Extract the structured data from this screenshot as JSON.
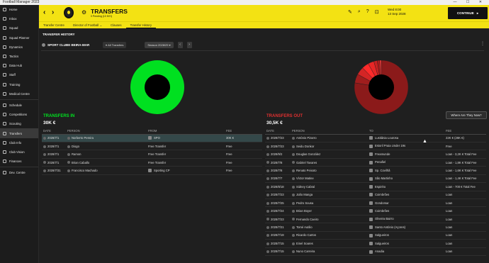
{
  "window": {
    "title": "Football Manager 2023"
  },
  "sidebar": {
    "items": [
      {
        "label": "Home",
        "icon": "home-icon"
      },
      {
        "label": "Inbox",
        "icon": "inbox-icon"
      },
      {
        "label": "Squad",
        "icon": "squad-icon"
      },
      {
        "label": "Squad Planner",
        "icon": "planner-icon"
      },
      {
        "label": "Dynamics",
        "icon": "dynamics-icon"
      },
      {
        "label": "Tactics",
        "icon": "tactics-icon"
      },
      {
        "label": "Data Hub",
        "icon": "data-icon"
      },
      {
        "label": "Staff",
        "icon": "staff-icon"
      },
      {
        "label": "Training",
        "icon": "training-icon"
      },
      {
        "label": "Medical Centre",
        "icon": "medical-icon"
      },
      {
        "label": "Schedule",
        "icon": "calendar-icon"
      },
      {
        "label": "Competitions",
        "icon": "trophy-icon"
      },
      {
        "label": "Scouting",
        "icon": "scouting-icon"
      },
      {
        "label": "Transfers",
        "icon": "transfers-icon"
      },
      {
        "label": "Club Info",
        "icon": "club-icon"
      },
      {
        "label": "Club Vision",
        "icon": "vision-icon"
      },
      {
        "label": "Finances",
        "icon": "finances-icon"
      },
      {
        "label": "Dev. Centre",
        "icon": "dev-icon"
      }
    ]
  },
  "header": {
    "title": "TRANSFERS",
    "subtitle": "0 Pending (10 H/H)",
    "date_line1": "Wed 8:00",
    "date_line2": "13 Sep 2028",
    "continue_label": "CONTINUE"
  },
  "subnav": {
    "tabs": [
      "Transfer Centre",
      "Director of Football",
      "Clauses",
      "Transfer History"
    ]
  },
  "main": {
    "section_title": "TRANSFER HISTORY",
    "club_name": "SPORT CLUBE BEIRA-MAR",
    "filter_label": "All Transfers",
    "season_label": "Season 2028/29",
    "where_button": "Where Are They Now?"
  },
  "colors": {
    "accent": "#f3e213",
    "in": "#00e020",
    "out": "#e03030"
  },
  "chart_data": [
    {
      "type": "pie",
      "title": "",
      "slices": [
        {
          "label": "Transfers In",
          "value": 30
        }
      ],
      "colors": [
        "#00e020"
      ]
    },
    {
      "type": "pie",
      "title": "",
      "slices": [
        {
          "value": 26
        },
        {
          "value": 1.8
        },
        {
          "value": 1.6
        },
        {
          "value": 1.4
        },
        {
          "value": 1.2
        },
        {
          "value": 0.7
        },
        {
          "value": 0.5
        },
        {
          "value": 0.3
        }
      ],
      "colors": [
        "#8b1a1a",
        "#a01d1d",
        "#d42525",
        "#ff2a2a",
        "#e82626",
        "#c92020",
        "#b01c1c",
        "#ff3a3a"
      ]
    }
  ],
  "transfers_in": {
    "title": "TRANSFERS IN",
    "total": "30K €",
    "headers": {
      "date": "DATE",
      "person": "PERSON",
      "from": "FROM",
      "fee": "FEE"
    },
    "rows": [
      {
        "date": "2028/7/1",
        "person": "Norberto Pereira",
        "club": "SPO",
        "fee": "30K €"
      },
      {
        "date": "2028/7/1",
        "person": "Diogo",
        "club": "Free Transfer",
        "fee": "Free"
      },
      {
        "date": "2028/7/1",
        "person": "Ramon",
        "club": "Free Transfer",
        "fee": "Free"
      },
      {
        "date": "2028/7/1",
        "person": "Brian Caballo",
        "club": "Free Transfer",
        "fee": "Free"
      },
      {
        "date": "2028/7/31",
        "person": "Francisco Machado",
        "club": "Sporting CP",
        "fee": "Free"
      }
    ]
  },
  "transfers_out": {
    "title": "TRANSFERS OUT",
    "total": "30,5K €",
    "headers": {
      "date": "DATE",
      "person": "PERSON",
      "to": "TO",
      "fee": "FEE"
    },
    "rows": [
      {
        "date": "2028/7/23",
        "person": "António Pizarro",
        "club": "Lusitânia Lourosa",
        "fee": "22K € (26K €)"
      },
      {
        "date": "2028/7/23",
        "person": "Seidu Donkor",
        "club": "Estoril Praia Under 19s",
        "fee": "Free"
      },
      {
        "date": "2028/9/2",
        "person": "Douglas González",
        "club": "Freamunde",
        "fee": "Loan - 3,2K € Total Fee"
      },
      {
        "date": "2028/7/8",
        "person": "Gabriel Tavares",
        "club": "Penafiel",
        "fee": "Loan - 1,8K € Total Fee"
      },
      {
        "date": "2028/7/8",
        "person": "Renato Peixoto",
        "club": "Sp. Covilhã",
        "fee": "Loan - 1,6K € Total Fee"
      },
      {
        "date": "2028/7/7",
        "person": "Víctor Matine",
        "club": "São Martinho",
        "fee": "Loan - 1,4K € Total Fee"
      },
      {
        "date": "2028/8/18",
        "person": "Sidney Cabral",
        "club": "Espinho",
        "fee": "Loan - 700 € Total Fee"
      },
      {
        "date": "2028/7/23",
        "person": "João Manga",
        "club": "Coimbrões",
        "fee": "Loan"
      },
      {
        "date": "2028/7/25",
        "person": "Pedro Sousa",
        "club": "Gondomar",
        "fee": "Loan"
      },
      {
        "date": "2028/7/24",
        "person": "Brian Boyer",
        "club": "Coimbrões",
        "fee": "Loan"
      },
      {
        "date": "2028/7/23",
        "person": "Fernando Caeiro",
        "club": "Oliveira Bairro",
        "fee": "Loan"
      },
      {
        "date": "2028/7/21",
        "person": "Tomé Autilio",
        "club": "Santo António (Açores)",
        "fee": "Loan"
      },
      {
        "date": "2028/7/19",
        "person": "Ricardo Cartos",
        "club": "Salgueiros",
        "fee": "Loan"
      },
      {
        "date": "2028/7/15",
        "person": "Einel Soares",
        "club": "Salgueiros",
        "fee": "Loan"
      },
      {
        "date": "2028/7/15",
        "person": "Nuno Carreira",
        "club": "Anadia",
        "fee": "Loan"
      }
    ]
  }
}
